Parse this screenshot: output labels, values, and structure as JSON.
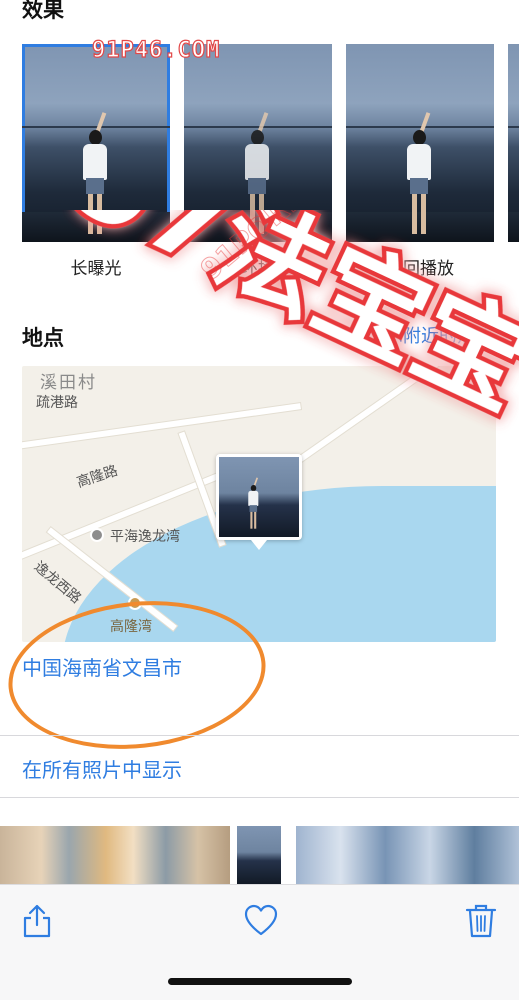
{
  "effects": {
    "title": "效果",
    "items": [
      {
        "label": "长曝光",
        "selected": true
      },
      {
        "label": "循环播放",
        "selected": false
      },
      {
        "label": "来回播放",
        "selected": false
      }
    ]
  },
  "watermarks": {
    "top_text": "91P46.COM",
    "big_text": "97法宝宝",
    "diagonal_text": "91PORN.COM"
  },
  "location": {
    "title": "地点",
    "nearby_link": "显示附近的照片",
    "map": {
      "labels": {
        "village": "溪田村",
        "road1": "疏港路",
        "road2": "高隆路",
        "poi": "平海逸龙湾",
        "road3": "逸龙西路",
        "bay": "高隆湾"
      }
    },
    "address": "中国海南省文昌市"
  },
  "show_all": "在所有照片中显示",
  "toolbar": {
    "share": "share-icon",
    "favorite": "heart-icon",
    "delete": "trash-icon"
  },
  "colors": {
    "accent": "#2f7de1",
    "circle": "#f08a2e",
    "watermark": "#e8383a"
  }
}
